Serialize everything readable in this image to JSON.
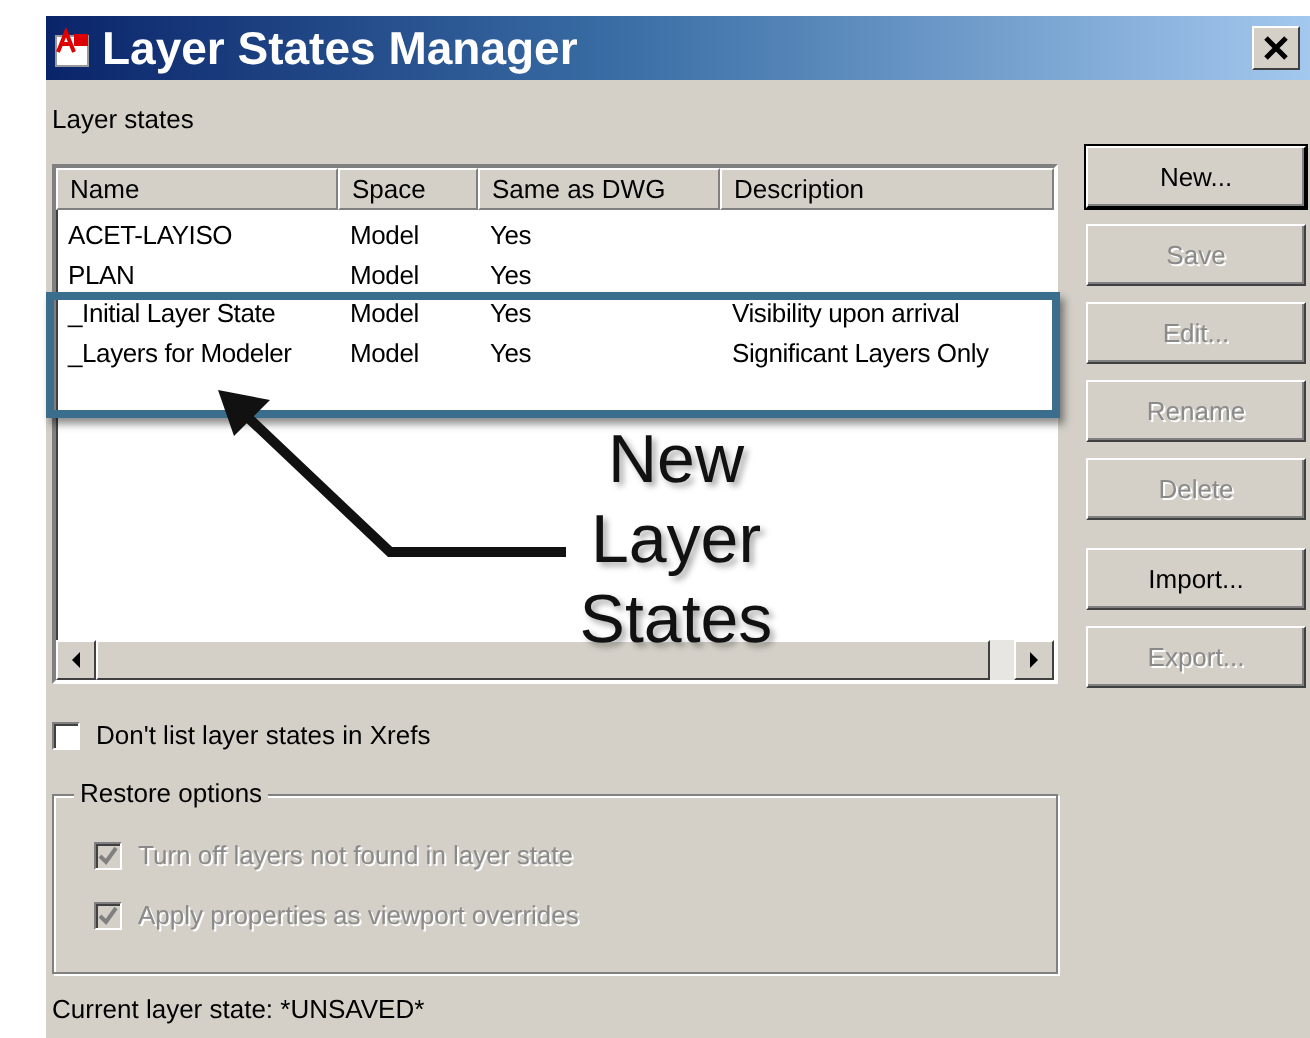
{
  "window": {
    "title": "Layer States Manager"
  },
  "layer_states": {
    "label": "Layer states",
    "columns": [
      "Name",
      "Space",
      "Same as DWG",
      "Description"
    ],
    "rows": [
      {
        "name": "ACET-LAYISO",
        "space": "Model",
        "same_as_dwg": "Yes"
      },
      {
        "name": "PLAN",
        "space": "Model",
        "same_as_dwg": "Yes"
      },
      {
        "name": "_Initial Layer State",
        "space": "Model",
        "same_as_dwg": "Yes",
        "description": "Visibility upon arrival"
      },
      {
        "name": "_Layers for Modeler",
        "space": "Model",
        "same_as_dwg": "Yes",
        "description": "Significant Layers Only"
      }
    ]
  },
  "buttons": [
    {
      "label": "New...",
      "disabled": false,
      "default": true
    },
    {
      "label": "Save",
      "disabled": true,
      "default": false
    },
    {
      "label": "Edit...",
      "disabled": true,
      "default": false
    },
    {
      "label": "Rename",
      "disabled": true,
      "default": false
    },
    {
      "label": "Delete",
      "disabled": true,
      "default": false
    },
    {
      "label": "Import...",
      "disabled": false,
      "default": false
    },
    {
      "label": "Export...",
      "disabled": true,
      "default": false
    }
  ],
  "dont_list_xrefs": {
    "label": "Don't list layer states in Xrefs",
    "checked": false,
    "disabled": false
  },
  "restore_options": {
    "title": "Restore options",
    "options": [
      {
        "label": "Turn off layers not found in layer state",
        "checked": true,
        "disabled": true
      },
      {
        "label": "Apply properties as viewport overrides",
        "checked": true,
        "disabled": true
      }
    ]
  },
  "current_layer_state": "Current layer state: *UNSAVED*",
  "annotation": {
    "text": "New Layer States"
  }
}
